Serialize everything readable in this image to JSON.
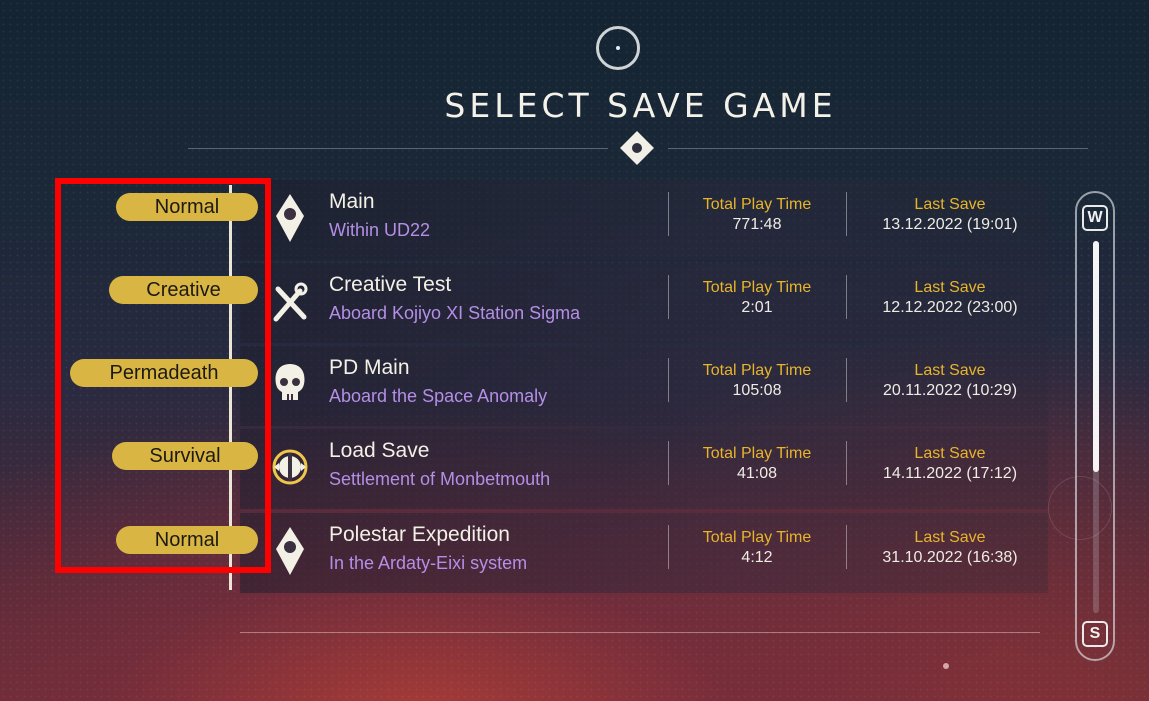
{
  "title": "SELECT SAVE GAME",
  "saves": [
    {
      "mode": "Normal",
      "name": "Main",
      "location": "Within UD22",
      "playtime_label": "Total Play Time",
      "playtime": "771:48",
      "lastsave_label": "Last Save",
      "lastsave": "13.12.2022 (19:01)",
      "icon": "location-pin-icon"
    },
    {
      "mode": "Creative",
      "name": "Creative Test",
      "location": "Aboard Kojiyo XI Station Sigma",
      "playtime_label": "Total Play Time",
      "playtime": "2:01",
      "lastsave_label": "Last Save",
      "lastsave": "12.12.2022 (23:00)",
      "icon": "wrench-screwdriver-icon"
    },
    {
      "mode": "Permadeath",
      "name": "PD Main",
      "location": "Aboard the Space Anomaly",
      "playtime_label": "Total Play Time",
      "playtime": "105:08",
      "lastsave_label": "Last Save",
      "lastsave": "20.11.2022 (10:29)",
      "icon": "skull-icon"
    },
    {
      "mode": "Survival",
      "name": "Load Save",
      "location": "Settlement of Monbetmouth",
      "playtime_label": "Total Play Time",
      "playtime": "41:08",
      "lastsave_label": "Last Save",
      "lastsave": "14.11.2022 (17:12)",
      "icon": "survival-shield-icon"
    },
    {
      "mode": "Normal",
      "name": "Polestar Expedition",
      "location": "In the Ardaty-Eixi system",
      "playtime_label": "Total Play Time",
      "playtime": "4:12",
      "lastsave_label": "Last Save",
      "lastsave": "31.10.2022 (16:38)",
      "icon": "location-pin-icon"
    }
  ],
  "scrollbar": {
    "up_key": "W",
    "down_key": "S",
    "position": 0.0,
    "visible_fraction": 0.62
  },
  "colors": {
    "accent_gold": "#d9b543",
    "location_purple": "#b58ee6",
    "label_orange": "#e8b42a",
    "highlight_red": "#ff0000"
  }
}
